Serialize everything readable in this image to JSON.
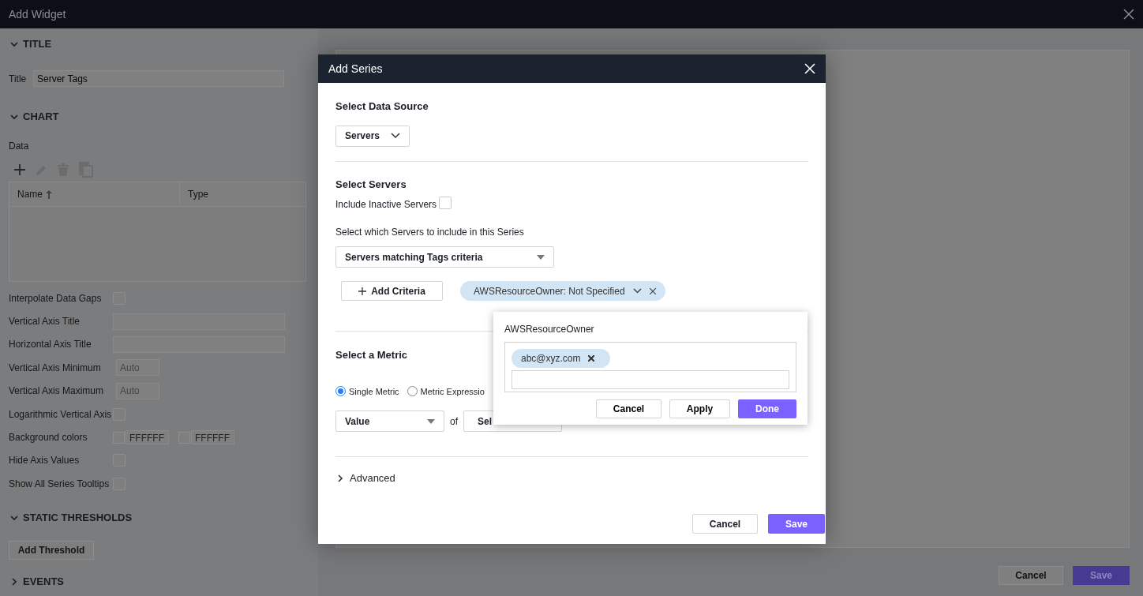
{
  "window": {
    "title": "Add Widget"
  },
  "sections": [
    {
      "kind": "title",
      "label": "TITLE",
      "expanded": true,
      "field_label": "Title",
      "value": "Server Tags"
    },
    {
      "kind": "chart",
      "label": "CHART",
      "expanded": true,
      "data_label": "Data",
      "columns": [
        {
          "label": "Name",
          "sorted": true
        },
        {
          "label": "Type",
          "sorted": false
        }
      ],
      "fields": [
        {
          "kind": "checkbox",
          "label": "Interpolate Data Gaps",
          "checked": false
        },
        {
          "kind": "text",
          "label": "Vertical Axis Title"
        },
        {
          "kind": "text",
          "label": "Horizontal Axis Title"
        },
        {
          "kind": "number",
          "label": "Vertical Axis Minimum",
          "placeholder": "Auto"
        },
        {
          "kind": "number",
          "label": "Vertical Axis Maximum",
          "placeholder": "Auto"
        },
        {
          "kind": "checkbox",
          "label": "Logarithmic Vertical Axis",
          "checked": false
        },
        {
          "kind": "colors",
          "label": "Background colors",
          "values": [
            "FFFFFF",
            "FFFFFF"
          ]
        },
        {
          "kind": "checkbox",
          "label": "Hide Axis Values",
          "checked": false
        },
        {
          "kind": "checkbox",
          "label": "Show All Series Tooltips",
          "checked": false
        }
      ]
    },
    {
      "kind": "thresholds",
      "label": "STATIC THRESHOLDS",
      "expanded": true,
      "button": "Add Threshold"
    },
    {
      "kind": "events",
      "label": "EVENTS",
      "expanded": false
    }
  ],
  "footer": {
    "cancel": "Cancel",
    "save": "Save"
  },
  "modal": {
    "title": "Add Series",
    "data_source": {
      "heading": "Select Data Source",
      "value": "Servers"
    },
    "servers": {
      "heading": "Select Servers",
      "inactive_label": "Include Inactive Servers",
      "inactive_checked": false,
      "hint": "Select which Servers to include in this Series",
      "value": "Servers matching Tags criteria",
      "add_button": "Add Criteria",
      "chip": "AWSResourceOwner: Not Specified"
    },
    "metric": {
      "heading": "Select a Metric",
      "options": [
        {
          "label": "Single Metric",
          "selected": true
        },
        {
          "label": "Metric Expressio",
          "selected": false
        }
      ],
      "aggregate": "Value",
      "of": "of",
      "metric_value": "Sel"
    },
    "advanced": {
      "label": "Advanced",
      "expanded": false
    },
    "cancel": "Cancel",
    "save": "Save"
  },
  "popover": {
    "title": "AWSResourceOwner",
    "tags": [
      "abc@xyz.com"
    ],
    "cancel": "Cancel",
    "apply": "Apply",
    "done": "Done"
  }
}
